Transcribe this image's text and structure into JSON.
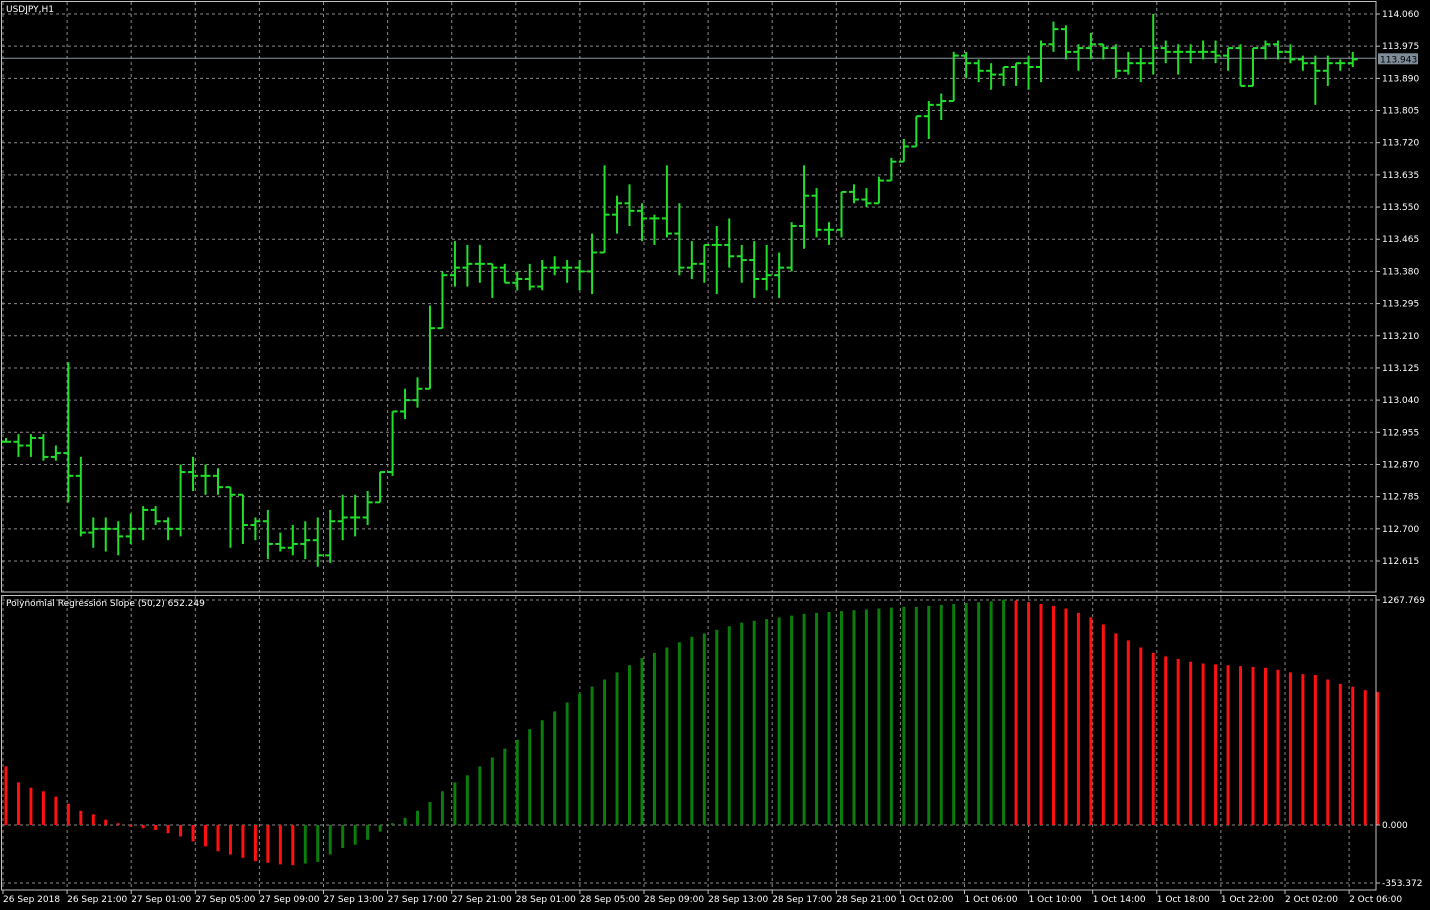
{
  "colors": {
    "background": "#000000",
    "grid": "#8a8a8a",
    "border": "#c0c0c0",
    "bar": "#22e02a",
    "hist_up": "#0b7d0b",
    "hist_down": "#ff1111",
    "text": "#ffffff",
    "price_tag_bg": "#7f8c99",
    "price_line": "#8a96a2"
  },
  "price_panel": {
    "title": "USDJPY,H1",
    "current_price_label": "113.943"
  },
  "indicator_panel": {
    "title": "Polynomial Regression Slope (50,2) 652.249"
  },
  "chart_data": [
    {
      "type": "ohlc",
      "title": "USDJPY,H1",
      "y_ticks": [
        "114.060",
        "113.975",
        "113.890",
        "113.805",
        "113.720",
        "113.635",
        "113.550",
        "113.465",
        "113.380",
        "113.295",
        "113.210",
        "113.125",
        "113.040",
        "112.955",
        "112.870",
        "112.785",
        "112.700",
        "112.615"
      ],
      "ylim": [
        112.55,
        114.08
      ],
      "current_price": 113.943,
      "x_ticks": [
        "26 Sep 2018",
        "26 Sep 21:00",
        "27 Sep 01:00",
        "27 Sep 05:00",
        "27 Sep 09:00",
        "27 Sep 13:00",
        "27 Sep 17:00",
        "27 Sep 21:00",
        "28 Sep 01:00",
        "28 Sep 05:00",
        "28 Sep 09:00",
        "28 Sep 13:00",
        "28 Sep 17:00",
        "28 Sep 21:00",
        "1 Oct 02:00",
        "1 Oct 06:00",
        "1 Oct 10:00",
        "1 Oct 14:00",
        "1 Oct 18:00",
        "1 Oct 22:00",
        "2 Oct 02:00",
        "2 Oct 06:00"
      ],
      "bars": [
        [
          112.93,
          112.94,
          112.93,
          112.93
        ],
        [
          112.93,
          112.95,
          112.89,
          112.92
        ],
        [
          112.92,
          112.95,
          112.89,
          112.94
        ],
        [
          112.94,
          112.95,
          112.88,
          112.89
        ],
        [
          112.89,
          112.92,
          112.88,
          112.9
        ],
        [
          112.9,
          113.14,
          112.77,
          112.84
        ],
        [
          112.84,
          112.89,
          112.68,
          112.69
        ],
        [
          112.69,
          112.73,
          112.65,
          112.7
        ],
        [
          112.7,
          112.73,
          112.64,
          112.7
        ],
        [
          112.7,
          112.72,
          112.63,
          112.68
        ],
        [
          112.68,
          112.74,
          112.66,
          112.7
        ],
        [
          112.7,
          112.76,
          112.67,
          112.75
        ],
        [
          112.75,
          112.76,
          112.71,
          112.72
        ],
        [
          112.72,
          112.73,
          112.67,
          112.7
        ],
        [
          112.7,
          112.87,
          112.68,
          112.85
        ],
        [
          112.85,
          112.89,
          112.8,
          112.84
        ],
        [
          112.84,
          112.87,
          112.79,
          112.84
        ],
        [
          112.84,
          112.86,
          112.79,
          112.81
        ],
        [
          112.81,
          112.8,
          112.65,
          112.79
        ],
        [
          112.79,
          112.75,
          112.66,
          112.71
        ],
        [
          112.71,
          112.73,
          112.67,
          112.72
        ],
        [
          112.72,
          112.75,
          112.62,
          112.66
        ],
        [
          112.66,
          112.69,
          112.64,
          112.65
        ],
        [
          112.65,
          112.71,
          112.63,
          112.66
        ],
        [
          112.66,
          112.72,
          112.62,
          112.67
        ],
        [
          112.67,
          112.73,
          112.6,
          112.63
        ],
        [
          112.63,
          112.75,
          112.61,
          112.72
        ],
        [
          112.72,
          112.79,
          112.67,
          112.73
        ],
        [
          112.73,
          112.79,
          112.68,
          112.73
        ],
        [
          112.73,
          112.8,
          112.71,
          112.77
        ],
        [
          112.77,
          112.85,
          112.77,
          112.85
        ],
        [
          112.85,
          113.0,
          112.84,
          113.01
        ],
        [
          113.01,
          113.07,
          112.99,
          113.04
        ],
        [
          113.04,
          113.1,
          113.02,
          113.07
        ],
        [
          113.07,
          113.29,
          113.1,
          113.23
        ],
        [
          113.23,
          113.38,
          113.24,
          113.37
        ],
        [
          113.37,
          113.46,
          113.34,
          113.39
        ],
        [
          113.39,
          113.45,
          113.34,
          113.4
        ],
        [
          113.4,
          113.45,
          113.35,
          113.4
        ],
        [
          113.4,
          113.4,
          113.31,
          113.39
        ],
        [
          113.39,
          113.4,
          113.35,
          113.35
        ],
        [
          113.35,
          113.38,
          113.33,
          113.36
        ],
        [
          113.36,
          113.4,
          113.33,
          113.34
        ],
        [
          113.34,
          113.41,
          113.33,
          113.39
        ],
        [
          113.39,
          113.42,
          113.37,
          113.39
        ],
        [
          113.39,
          113.41,
          113.35,
          113.39
        ],
        [
          113.39,
          113.41,
          113.33,
          113.38
        ],
        [
          113.38,
          113.48,
          113.32,
          113.43
        ],
        [
          113.43,
          113.66,
          113.44,
          113.53
        ],
        [
          113.53,
          113.58,
          113.48,
          113.56
        ],
        [
          113.56,
          113.61,
          113.5,
          113.54
        ],
        [
          113.54,
          113.56,
          113.46,
          113.52
        ],
        [
          113.52,
          113.53,
          113.45,
          113.52
        ],
        [
          113.52,
          113.66,
          113.47,
          113.48
        ],
        [
          113.48,
          113.56,
          113.37,
          113.39
        ],
        [
          113.39,
          113.46,
          113.36,
          113.4
        ],
        [
          113.4,
          113.44,
          113.35,
          113.45
        ],
        [
          113.45,
          113.5,
          113.32,
          113.45
        ],
        [
          113.45,
          113.52,
          113.39,
          113.42
        ],
        [
          113.42,
          113.45,
          113.35,
          113.41
        ],
        [
          113.41,
          113.46,
          113.31,
          113.36
        ],
        [
          113.36,
          113.45,
          113.33,
          113.37
        ],
        [
          113.37,
          113.43,
          113.31,
          113.39
        ],
        [
          113.39,
          113.51,
          113.38,
          113.5
        ],
        [
          113.5,
          113.66,
          113.44,
          113.58
        ],
        [
          113.58,
          113.6,
          113.47,
          113.49
        ],
        [
          113.49,
          113.51,
          113.45,
          113.49
        ],
        [
          113.49,
          113.58,
          113.47,
          113.59
        ],
        [
          113.59,
          113.61,
          113.56,
          113.57
        ],
        [
          113.57,
          113.6,
          113.55,
          113.56
        ],
        [
          113.56,
          113.63,
          113.56,
          113.62
        ],
        [
          113.62,
          113.68,
          113.62,
          113.67
        ],
        [
          113.67,
          113.73,
          113.68,
          113.71
        ],
        [
          113.71,
          113.75,
          113.71,
          113.79
        ],
        [
          113.79,
          113.83,
          113.73,
          113.82
        ],
        [
          113.82,
          113.85,
          113.78,
          113.83
        ],
        [
          113.83,
          113.96,
          113.83,
          113.95
        ],
        [
          113.95,
          113.96,
          113.89,
          113.93
        ],
        [
          113.93,
          113.94,
          113.88,
          113.91
        ],
        [
          113.91,
          113.93,
          113.86,
          113.9
        ],
        [
          113.9,
          113.92,
          113.87,
          113.92
        ],
        [
          113.92,
          113.93,
          113.87,
          113.93
        ],
        [
          113.93,
          113.95,
          113.86,
          113.92
        ],
        [
          113.92,
          113.99,
          113.88,
          113.98
        ],
        [
          113.98,
          114.04,
          113.96,
          114.02
        ],
        [
          114.02,
          114.03,
          113.94,
          113.96
        ],
        [
          113.96,
          113.98,
          113.91,
          113.97
        ],
        [
          113.97,
          114.01,
          113.94,
          113.98
        ],
        [
          113.98,
          113.98,
          113.94,
          113.97
        ],
        [
          113.97,
          113.98,
          113.89,
          113.91
        ],
        [
          113.91,
          113.96,
          113.9,
          113.93
        ],
        [
          113.93,
          113.97,
          113.88,
          113.93
        ],
        [
          113.93,
          114.06,
          113.9,
          113.97
        ],
        [
          113.97,
          113.99,
          113.93,
          113.96
        ],
        [
          113.96,
          113.98,
          113.9,
          113.96
        ],
        [
          113.96,
          113.98,
          113.93,
          113.96
        ],
        [
          113.96,
          113.99,
          113.94,
          113.96
        ],
        [
          113.96,
          113.99,
          113.93,
          113.95
        ],
        [
          113.95,
          113.97,
          113.91,
          113.97
        ],
        [
          113.97,
          113.98,
          113.87,
          113.87
        ],
        [
          113.87,
          113.97,
          113.87,
          113.97
        ],
        [
          113.97,
          113.99,
          113.94,
          113.98
        ],
        [
          113.98,
          113.99,
          113.94,
          113.96
        ],
        [
          113.96,
          113.98,
          113.93,
          113.94
        ],
        [
          113.94,
          113.95,
          113.91,
          113.93
        ],
        [
          113.93,
          113.95,
          113.82,
          113.91
        ],
        [
          113.91,
          113.95,
          113.87,
          113.93
        ],
        [
          113.93,
          113.94,
          113.91,
          113.93
        ],
        [
          113.93,
          113.96,
          113.92,
          113.94
        ]
      ]
    },
    {
      "type": "bar",
      "title": "Polynomial Regression Slope (50,2) 652.249",
      "y_ticks": [
        "1267.769",
        "0.000",
        "-353.372"
      ],
      "ylim": [
        -353.372,
        1267.769
      ],
      "values": [
        330,
        240,
        210,
        190,
        160,
        120,
        80,
        60,
        30,
        10,
        -10,
        -20,
        -30,
        -50,
        -70,
        -100,
        -130,
        -160,
        -180,
        -200,
        -220,
        -230,
        -240,
        -245,
        -235,
        -225,
        -180,
        -140,
        -120,
        -90,
        -40,
        10,
        40,
        80,
        130,
        190,
        240,
        280,
        330,
        380,
        430,
        480,
        540,
        590,
        640,
        690,
        740,
        780,
        820,
        860,
        900,
        940,
        970,
        1000,
        1030,
        1060,
        1080,
        1100,
        1120,
        1140,
        1150,
        1160,
        1170,
        1180,
        1190,
        1195,
        1200,
        1205,
        1210,
        1215,
        1220,
        1225,
        1230,
        1230,
        1235,
        1240,
        1245,
        1250,
        1255,
        1260,
        1270,
        1265,
        1255,
        1245,
        1235,
        1220,
        1195,
        1170,
        1130,
        1080,
        1040,
        1000,
        970,
        950,
        935,
        920,
        910,
        905,
        900,
        895,
        890,
        885,
        875,
        860,
        850,
        845,
        820,
        795,
        780,
        760,
        750
      ],
      "value_colors": "red = slope decreasing vs prior bar, green = increasing"
    }
  ]
}
